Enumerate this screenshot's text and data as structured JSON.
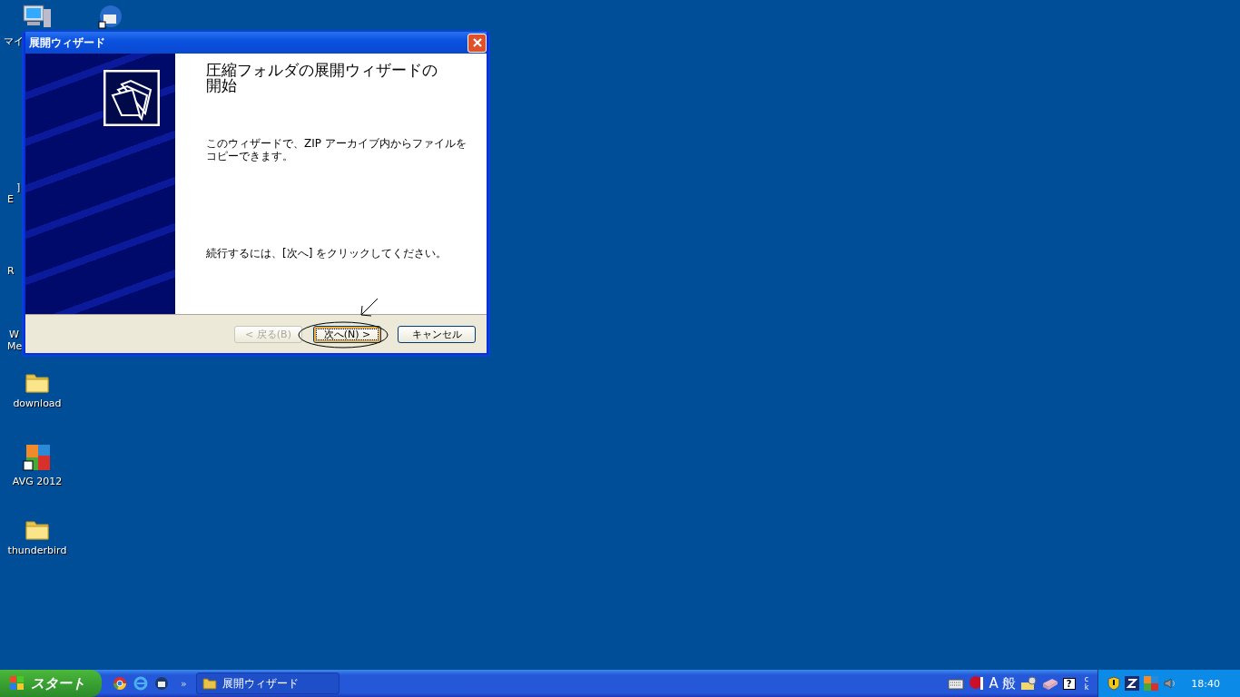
{
  "desktop": {
    "hidden_labels": [
      "マイ",
      "]",
      "E",
      "R",
      "W",
      "Me"
    ],
    "icons": [
      {
        "label": "download",
        "kind": "folder"
      },
      {
        "label": "AVG 2012",
        "kind": "avg"
      },
      {
        "label": "thunderbird",
        "kind": "folder"
      }
    ]
  },
  "window": {
    "title": "展開ウィザード",
    "heading": "圧縮フォルダの展開ウィザードの開始",
    "description": "このウィザードで、ZIP アーカイブ内からファイルをコピーできます。",
    "instruction": "続行するには、[次へ] をクリックしてください。",
    "buttons": [
      {
        "label": "< 戻る(B)",
        "disabled": true,
        "focused": false
      },
      {
        "label": "次へ(N) >",
        "disabled": false,
        "focused": true
      },
      {
        "label": "キャンセル",
        "disabled": false,
        "focused": false
      }
    ]
  },
  "taskbar": {
    "start": "スタート",
    "more": "»",
    "tasks": [
      {
        "label": "展開ウィザード",
        "selected": false
      }
    ],
    "language_bar": [
      "A",
      "般"
    ],
    "help": "?",
    "mini": [
      "c",
      "k"
    ],
    "clock": "18:40"
  }
}
